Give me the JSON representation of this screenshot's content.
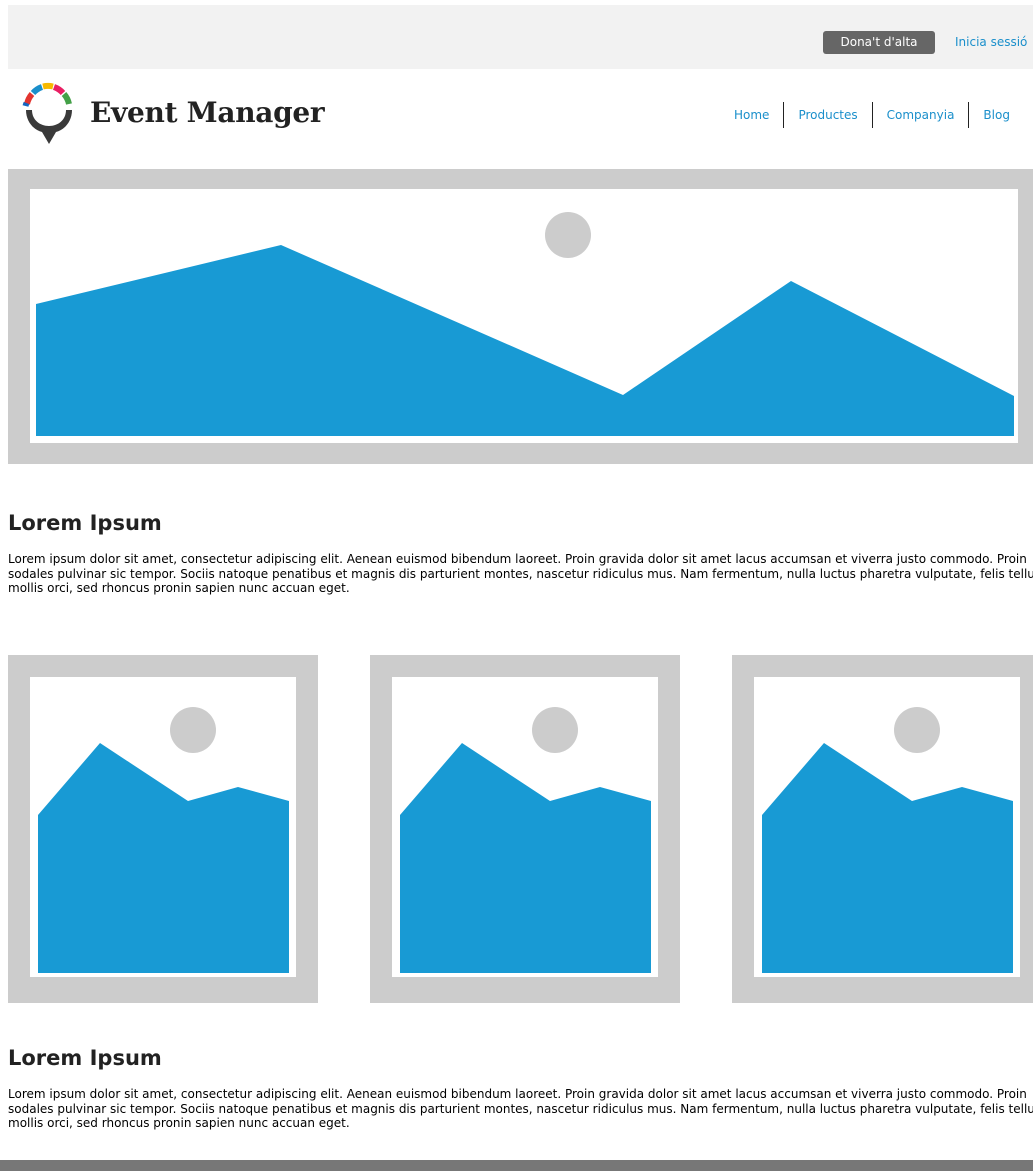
{
  "topbar": {
    "signup_label": "Dona't d'alta",
    "login_label": "Inicia sessió"
  },
  "header": {
    "brand": "Event Manager",
    "nav": [
      "Home",
      "Productes",
      "Companyia",
      "Blog"
    ]
  },
  "sections": [
    {
      "title": "Lorem Ipsum",
      "text": "Lorem ipsum dolor sit amet, consectetur adipiscing elit. Aenean euismod bibendum laoreet. Proin gravida dolor sit amet lacus accumsan et viverra justo commodo. Proin sodales pulvinar sic tempor. Sociis natoque penatibus et magnis dis parturient montes, nascetur ridiculus mus. Nam fermentum, nulla luctus pharetra vulputate, felis tellus mollis orci, sed rhoncus pronin sapien nunc accuan eget."
    },
    {
      "title": "Lorem Ipsum",
      "text": "Lorem ipsum dolor sit amet, consectetur adipiscing elit. Aenean euismod bibendum laoreet. Proin gravida dolor sit amet lacus accumsan et viverra justo commodo. Proin sodales pulvinar sic tempor. Sociis natoque penatibus et magnis dis parturient montes, nascetur ridiculus mus. Nam fermentum, nulla luctus pharetra vulputate, felis tellus mollis orci, sed rhoncus pronin sapien nunc accuan eget."
    }
  ],
  "colors": {
    "accent": "#1a8fcb",
    "placeholder_frame": "#cccccc",
    "placeholder_fill": "#189ad4",
    "topbar_bg": "#f2f2f2",
    "button_bg": "#666666",
    "footer_bg": "#777777"
  },
  "icons": {
    "logo": "event-manager-logo",
    "hero": "image-placeholder-icon",
    "thumbs": [
      "image-placeholder-icon",
      "image-placeholder-icon",
      "image-placeholder-icon"
    ]
  }
}
